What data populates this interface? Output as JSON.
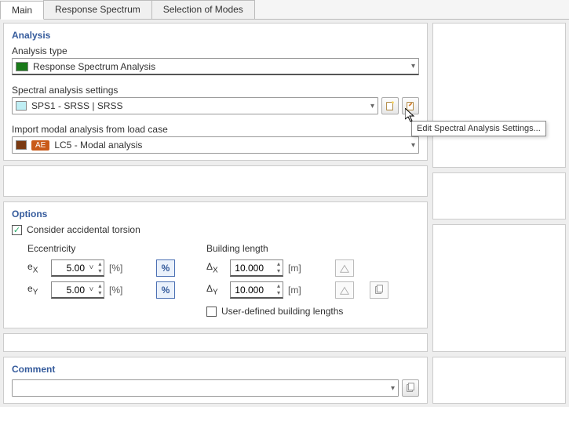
{
  "tabs": [
    {
      "label": "Main",
      "active": true
    },
    {
      "label": "Response Spectrum",
      "active": false
    },
    {
      "label": "Selection of Modes",
      "active": false
    }
  ],
  "analysis": {
    "title": "Analysis",
    "type_label": "Analysis type",
    "type_value": "Response Spectrum Analysis",
    "spectral_label": "Spectral analysis settings",
    "spectral_value": "SPS1 - SRSS | SRSS",
    "import_label": "Import modal analysis from load case",
    "import_badge": "AE",
    "import_value": "LC5 - Modal analysis",
    "tooltip": "Edit Spectral Analysis Settings..."
  },
  "options": {
    "title": "Options",
    "accidental_torsion_label": "Consider accidental torsion",
    "accidental_torsion_checked": true,
    "eccentricity": {
      "title": "Eccentricity",
      "rows": [
        {
          "label": "eX",
          "value": "5.00",
          "unit": "[%]"
        },
        {
          "label": "eY",
          "value": "5.00",
          "unit": "[%]"
        }
      ]
    },
    "building_length": {
      "title": "Building length",
      "rows": [
        {
          "label": "ΔX",
          "value": "10.000",
          "unit": "[m]"
        },
        {
          "label": "ΔY",
          "value": "10.000",
          "unit": "[m]"
        }
      ],
      "user_defined_label": "User-defined building lengths",
      "user_defined_checked": false
    }
  },
  "comment": {
    "title": "Comment",
    "value": ""
  },
  "colors": {
    "accent": "#355b9c"
  }
}
